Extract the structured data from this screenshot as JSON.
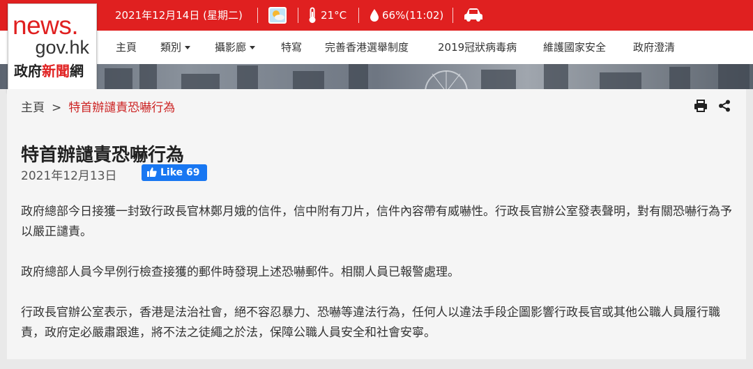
{
  "topbar": {
    "date": "2021年12月14日 (星期二)",
    "weather_icon": "sunny-cloud-icon",
    "temperature": "21°C",
    "humidity": "66%(11:02)",
    "traffic_icon": "car-icon"
  },
  "logo": {
    "line1": "news.",
    "line2": "gov.hk",
    "line3_a": "政府",
    "line3_b": "新聞",
    "line3_c": "網"
  },
  "nav": {
    "items": [
      "主頁",
      "類別",
      "攝影廊",
      "特寫",
      "完善香港選舉制度",
      "2019冠狀病毒病",
      "維護國家安全",
      "政府澄清"
    ]
  },
  "breadcrumb": {
    "home": "主頁",
    "sep": ">",
    "current": "特首辦譴責恐嚇行為"
  },
  "article": {
    "title": "特首辦譴責恐嚇行為",
    "date": "2021年12月13日",
    "like_label": "Like 69",
    "paragraphs": [
      "政府總部今日接獲一封致行政長官林鄭月娥的信件，信中附有刀片，信件內容帶有威嚇性。行政長官辦公室發表聲明，對有關恐嚇行為予以嚴正譴責。",
      "政府總部人員今早例行檢查接獲的郵件時發現上述恐嚇郵件。相關人員已報警處理。",
      "行政長官辦公室表示，香港是法治社會，絕不容忍暴力、恐嚇等違法行為，任何人以違法手段企圖影響行政長官或其他公職人員履行職責，政府定必嚴肅跟進，將不法之徒繩之於法，保障公職人員安全和社會安寧。"
    ]
  },
  "colors": {
    "brand_red": "#e02020",
    "breadcrumb_current": "#cc2222",
    "facebook_blue": "#1877f2"
  }
}
